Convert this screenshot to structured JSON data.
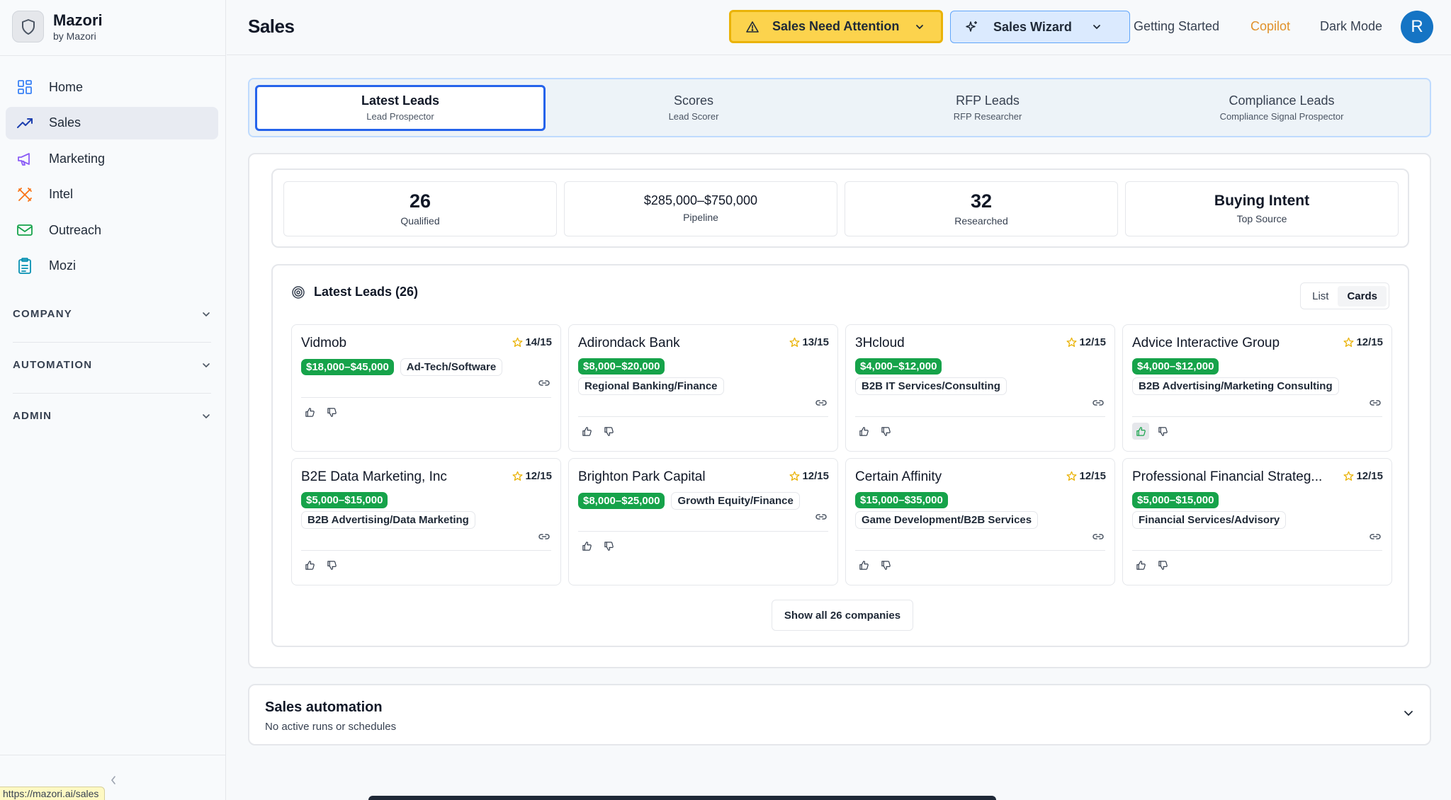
{
  "brand": {
    "name": "Mazori",
    "sub": "by Mazori"
  },
  "nav": [
    {
      "label": "Home",
      "icon": "grid-icon"
    },
    {
      "label": "Sales",
      "icon": "trend-up-icon",
      "active": true
    },
    {
      "label": "Marketing",
      "icon": "megaphone-icon"
    },
    {
      "label": "Intel",
      "icon": "tools-icon"
    },
    {
      "label": "Outreach",
      "icon": "mail-icon"
    },
    {
      "label": "Mozi",
      "icon": "clipboard-icon"
    }
  ],
  "sections": [
    "COMPANY",
    "AUTOMATION",
    "ADMIN"
  ],
  "status_url": "https://mazori.ai/sales",
  "header": {
    "title": "Sales",
    "attention": "Sales Need Attention",
    "wizard": "Sales Wizard",
    "getting_started": "Getting Started",
    "copilot": "Copilot",
    "dark_mode": "Dark Mode",
    "avatar": "R"
  },
  "tabs": [
    {
      "title": "Latest Leads",
      "sub": "Lead Prospector",
      "active": true
    },
    {
      "title": "Scores",
      "sub": "Lead Scorer"
    },
    {
      "title": "RFP Leads",
      "sub": "RFP Researcher"
    },
    {
      "title": "Compliance Leads",
      "sub": "Compliance Signal Prospector"
    }
  ],
  "stats": [
    {
      "value": "26",
      "label": "Qualified"
    },
    {
      "value": "$285,000–$750,000",
      "label": "Pipeline"
    },
    {
      "value": "32",
      "label": "Researched"
    },
    {
      "value": "Buying Intent",
      "label": "Top Source"
    }
  ],
  "leads": {
    "title": "Latest Leads (26)",
    "view_list": "List",
    "view_cards": "Cards",
    "show_all": "Show all 26 companies",
    "cards": [
      {
        "name": "Vidmob",
        "score": "14/15",
        "range": "$18,000–$45,000",
        "industry": "Ad-Tech/Software",
        "inline": true
      },
      {
        "name": "Adirondack Bank",
        "score": "13/15",
        "range": "$8,000–$20,000",
        "industry": "Regional Banking/Finance",
        "inline": false
      },
      {
        "name": "3Hcloud",
        "score": "12/15",
        "range": "$4,000–$12,000",
        "industry": "B2B IT Services/Consulting",
        "inline": false
      },
      {
        "name": "Advice Interactive Group",
        "score": "12/15",
        "range": "$4,000–$12,000",
        "industry": "B2B Advertising/Marketing Consulting",
        "inline": false,
        "liked": true
      },
      {
        "name": "B2E Data Marketing, Inc",
        "score": "12/15",
        "range": "$5,000–$15,000",
        "industry": "B2B Advertising/Data Marketing",
        "inline": false
      },
      {
        "name": "Brighton Park Capital",
        "score": "12/15",
        "range": "$8,000–$25,000",
        "industry": "Growth Equity/Finance",
        "inline": true
      },
      {
        "name": "Certain Affinity",
        "score": "12/15",
        "range": "$15,000–$35,000",
        "industry": "Game Development/B2B Services",
        "inline": false
      },
      {
        "name": "Professional Financial Strateg...",
        "score": "12/15",
        "range": "$5,000–$15,000",
        "industry": "Financial Services/Advisory",
        "inline": false
      }
    ]
  },
  "automation": {
    "title": "Sales automation",
    "sub": "No active runs or schedules"
  },
  "colors": {
    "accent": "#2563eb",
    "attention": "#fcd34d",
    "money": "#16a34a",
    "avatar": "#1574c4",
    "copilot": "#e0912a"
  }
}
